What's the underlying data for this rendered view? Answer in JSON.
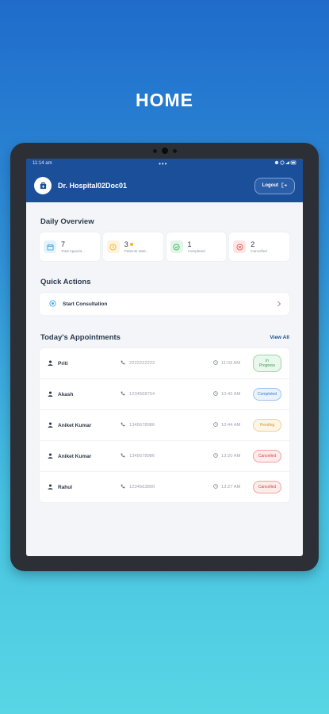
{
  "page": {
    "heading": "HOME"
  },
  "status_bar": {
    "time": "11:14 am",
    "dots": "•••"
  },
  "header": {
    "doctor_name": "Dr. Hospital02Doc01",
    "logout_label": "Logout"
  },
  "daily_overview": {
    "title": "Daily Overview",
    "stats": [
      {
        "value": "7",
        "label": "Total Appoint...",
        "icon": "calendar-icon",
        "color": "#3ba7e6"
      },
      {
        "value": "3",
        "label": "Patients Wait...",
        "icon": "clock-icon",
        "color": "#f2b531"
      },
      {
        "value": "1",
        "label": "Completed",
        "icon": "check-circle-icon",
        "color": "#3cb35d"
      },
      {
        "value": "2",
        "label": "Cancelled",
        "icon": "x-circle-icon",
        "color": "#e35a55"
      }
    ]
  },
  "quick_actions": {
    "title": "Quick Actions",
    "start_consultation": "Start Consultation"
  },
  "appointments": {
    "title": "Today's Appointments",
    "view_all": "View All",
    "items": [
      {
        "name": "Priti",
        "phone": "2222222222",
        "time": "11:03 AM",
        "status": "In Progress",
        "variant": "prog"
      },
      {
        "name": "Akash",
        "phone": "1234568754",
        "time": "10:42 AM",
        "status": "Completed",
        "variant": "comp"
      },
      {
        "name": "Aniket Kumar",
        "phone": "1345678986",
        "time": "10:44 AM",
        "status": "Pending",
        "variant": "pend"
      },
      {
        "name": "Aniket Kumar",
        "phone": "1345678986",
        "time": "13:20 AM",
        "status": "Cancelled",
        "variant": "canc"
      },
      {
        "name": "Rahul",
        "phone": "1234563890",
        "time": "13:27 AM",
        "status": "Cancelled",
        "variant": "canc"
      }
    ]
  }
}
